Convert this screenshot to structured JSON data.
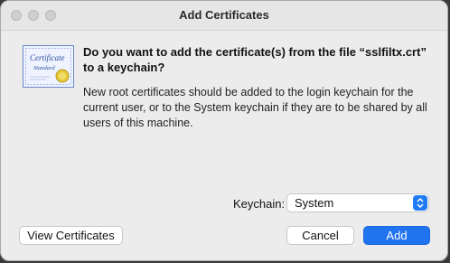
{
  "window": {
    "title": "Add Certificates"
  },
  "dialog": {
    "icon": "certificate-standard-icon",
    "icon_text": "Certificate Standard",
    "question": "Do you want to add the certificate(s) from the file “sslfiltx.crt” to a keychain?",
    "info": "New root certificates should be added to the login keychain for the current user, or to the System keychain if they are to be shared by all users of this machine."
  },
  "keychain": {
    "label": "Keychain:",
    "selected": "System"
  },
  "buttons": {
    "view_certificates": "View Certificates",
    "cancel": "Cancel",
    "add": "Add"
  },
  "colors": {
    "accent": "#2174f0",
    "window_bg": "#ececec"
  }
}
